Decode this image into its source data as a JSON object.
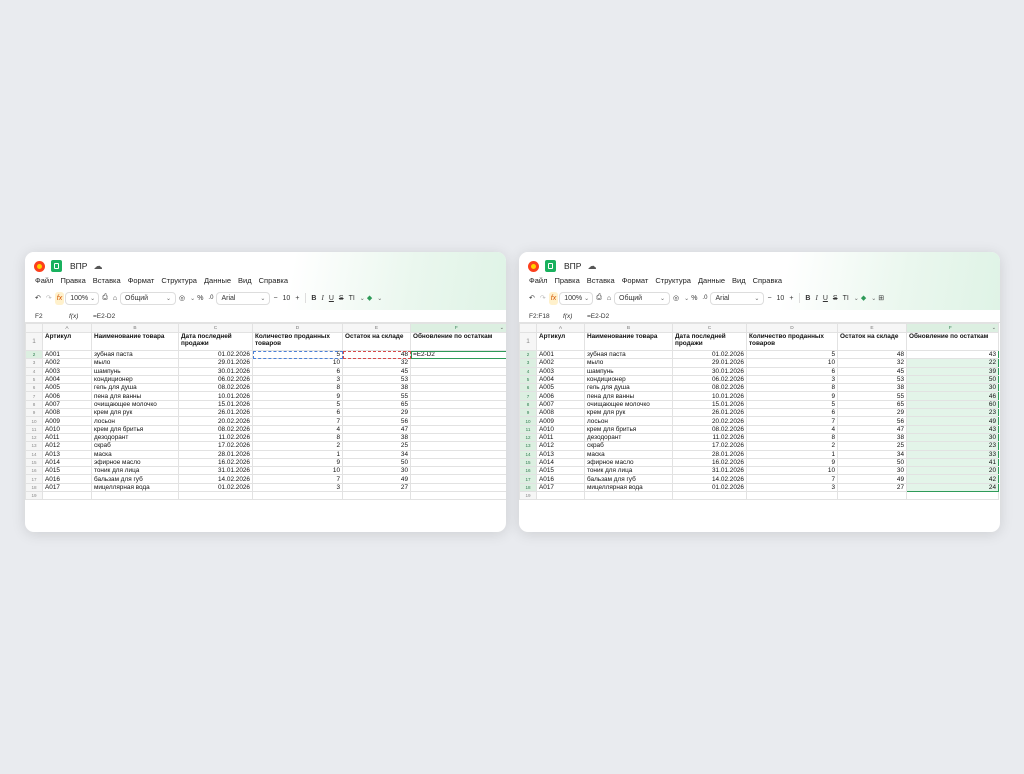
{
  "app": {
    "title": "ВПР",
    "menu": [
      "Файл",
      "Правка",
      "Вставка",
      "Формат",
      "Структура",
      "Данные",
      "Вид",
      "Справка"
    ],
    "toolbar": {
      "zoom": "100%",
      "number_format": "Общий",
      "font": "Arial",
      "font_size": "10",
      "minus": "−",
      "plus": "+",
      "percent": "%",
      "bold": "B",
      "italic": "I",
      "underline": "U",
      "strike": "S",
      "text_format": "TI",
      "fx": "fx"
    },
    "fx_label": "f(x)"
  },
  "columns": [
    "A",
    "B",
    "C",
    "D",
    "E",
    "F"
  ],
  "headers": [
    "Артикул",
    "Наименование товара",
    "Дата последней продажи",
    "Количество проданных товаров",
    "Остаток на складе",
    "Обновление по остаткам"
  ],
  "rows": [
    [
      "A001",
      "зубная паста",
      "01.02.2026",
      "5",
      "48"
    ],
    [
      "A002",
      "мыло",
      "29.01.2026",
      "10",
      "32"
    ],
    [
      "A003",
      "шампунь",
      "30.01.2026",
      "6",
      "45"
    ],
    [
      "A004",
      "кондиционер",
      "06.02.2026",
      "3",
      "53"
    ],
    [
      "A005",
      "гель для душа",
      "08.02.2026",
      "8",
      "38"
    ],
    [
      "A006",
      "пена для ванны",
      "10.01.2026",
      "9",
      "55"
    ],
    [
      "A007",
      "очищающее молочко",
      "15.01.2026",
      "5",
      "65"
    ],
    [
      "A008",
      "крем для рук",
      "26.01.2026",
      "6",
      "29"
    ],
    [
      "A009",
      "лосьон",
      "20.02.2026",
      "7",
      "56"
    ],
    [
      "A010",
      "крем для бритья",
      "08.02.2026",
      "4",
      "47"
    ],
    [
      "A011",
      "дезодорант",
      "11.02.2026",
      "8",
      "38"
    ],
    [
      "A012",
      "скраб",
      "17.02.2026",
      "2",
      "25"
    ],
    [
      "A013",
      "маска",
      "28.01.2026",
      "1",
      "34"
    ],
    [
      "A014",
      "эфирное масло",
      "16.02.2026",
      "9",
      "50"
    ],
    [
      "A015",
      "тоник для лица",
      "31.01.2026",
      "10",
      "30"
    ],
    [
      "A016",
      "бальзам для губ",
      "14.02.2026",
      "7",
      "49"
    ],
    [
      "A017",
      "мицеллярная вода",
      "01.02.2026",
      "3",
      "27"
    ]
  ],
  "row_numbers": [
    "1",
    "2",
    "3",
    "4",
    "5",
    "6",
    "7",
    "8",
    "9",
    "10",
    "11",
    "12",
    "13",
    "14",
    "15",
    "16",
    "17",
    "18",
    "19"
  ],
  "left": {
    "cell_ref": "F2",
    "formula": "=E2-D2",
    "f2_value": "=E2-D2"
  },
  "right": {
    "cell_ref": "F2:F18",
    "formula": "=E2-D2",
    "f_values": [
      "43",
      "22",
      "39",
      "50",
      "30",
      "46",
      "60",
      "23",
      "49",
      "43",
      "30",
      "23",
      "33",
      "41",
      "20",
      "42",
      "24"
    ]
  }
}
